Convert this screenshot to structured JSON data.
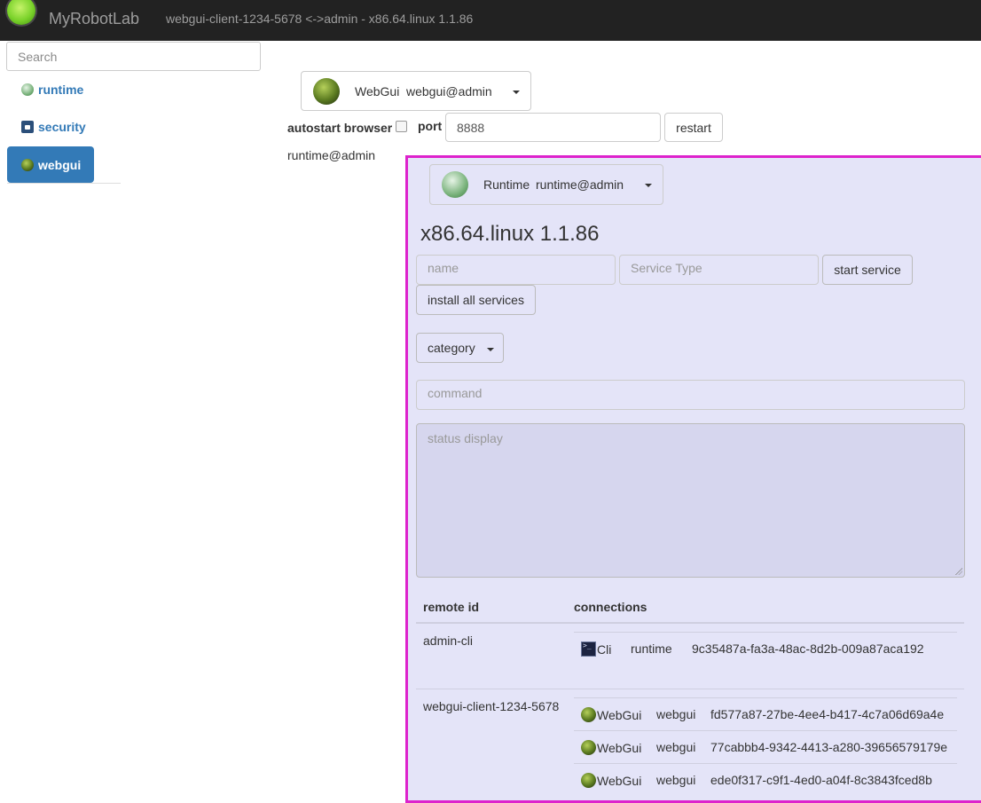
{
  "navbar": {
    "brand": "MyRobotLab",
    "connection_text": "webgui-client-1234-5678 <->admin - x86.64.linux 1.1.86"
  },
  "sidebar": {
    "search_placeholder": "Search",
    "items": [
      {
        "label": "runtime",
        "icon": "runtime-icon"
      },
      {
        "label": "security",
        "icon": "lock-icon"
      },
      {
        "label": "webgui",
        "icon": "globe-icon",
        "active": true
      }
    ]
  },
  "webgui_panel": {
    "service_type": "WebGui",
    "service_name": "webgui@admin",
    "autostart_label": "autostart browser",
    "port_label": "port",
    "port_value": "8888",
    "restart_label": "restart",
    "runtime_label": "runtime@admin"
  },
  "runtime_panel": {
    "service_type": "Runtime",
    "service_name": "runtime@admin",
    "platform_title": "x86.64.linux 1.1.86",
    "name_placeholder": "name",
    "service_type_placeholder": "Service Type",
    "start_service_label": "start service",
    "install_all_label": "install all services",
    "category_label": "category",
    "command_placeholder": "command",
    "status_placeholder": "status display",
    "table": {
      "headers": [
        "remote id",
        "connections"
      ],
      "rows": [
        {
          "remote_id": "admin-cli",
          "connections": [
            {
              "type": "Cli",
              "icon": "cli-icon",
              "name": "runtime",
              "id": "9c35487a-fa3a-48ac-8d2b-009a87aca192"
            }
          ]
        },
        {
          "remote_id": "webgui-client-1234-5678",
          "connections": [
            {
              "type": "WebGui",
              "icon": "globe-icon",
              "name": "webgui",
              "id": "fd577a87-27be-4ee4-b417-4c7a06d69a4e"
            },
            {
              "type": "WebGui",
              "icon": "globe-icon",
              "name": "webgui",
              "id": "77cabbb4-9342-4413-a280-39656579179e"
            },
            {
              "type": "WebGui",
              "icon": "globe-icon",
              "name": "webgui",
              "id": "ede0f317-c9f1-4ed0-a04f-8c3843fced8b"
            }
          ]
        }
      ]
    }
  }
}
